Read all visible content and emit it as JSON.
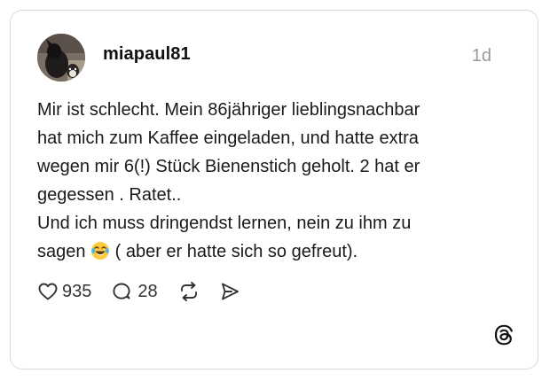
{
  "post": {
    "username": "miapaul81",
    "timestamp": "1d",
    "text_part1": "Mir ist schlecht. Mein 86jähriger lieblingsnachbar\nhat mich zum Kaffee eingeladen, und hatte extra\nwegen mir 6(!) Stück Bienenstich geholt. 2 hat er\ngegessen . Ratet..\nUnd ich muss dringendst lernen, nein zu ihm zu\nsagen ",
    "emoji": "😂",
    "text_part2": " ( aber er hatte sich so gefreut).",
    "likes": "935",
    "replies": "28"
  },
  "icons": {
    "like": "heart-icon",
    "reply": "comment-icon",
    "repost": "repost-icon",
    "share": "send-icon",
    "brand": "threads-logo-icon"
  },
  "colors": {
    "text": "#1a1a1a",
    "muted": "#999999",
    "border": "#d9d9d9",
    "icon": "#333333"
  }
}
